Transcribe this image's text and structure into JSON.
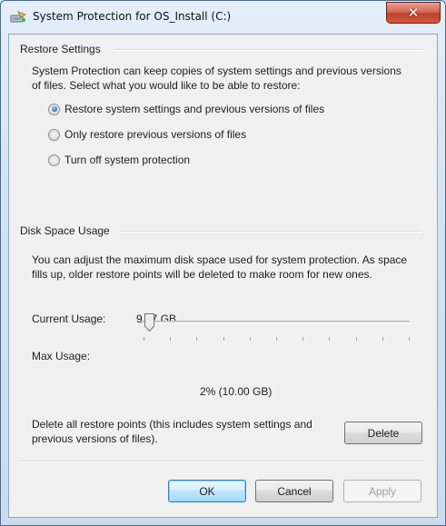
{
  "window": {
    "title": "System Protection for OS_Install (C:)",
    "close_label": "✕"
  },
  "restore_settings": {
    "group_title": "Restore Settings",
    "description": "System Protection can keep copies of system settings and previous versions of files. Select what you would like to be able to restore:",
    "options": [
      {
        "label": "Restore system settings and previous versions of files",
        "checked": true
      },
      {
        "label": "Only restore previous versions of files",
        "checked": false
      },
      {
        "label": "Turn off system protection",
        "checked": false
      }
    ]
  },
  "disk_space": {
    "group_title": "Disk Space Usage",
    "description": "You can adjust the maximum disk space used for system protection. As space fills up, older restore points will be deleted to make room for new ones.",
    "current_usage_label": "Current Usage:",
    "current_usage_value": "9.17 GB",
    "max_usage_label": "Max Usage:",
    "max_usage_percent": 2,
    "max_usage_display": "2% (10.00 GB)",
    "delete_description": "Delete all restore points (this includes system settings and previous versions of files).",
    "delete_label": "Delete"
  },
  "buttons": {
    "ok": "OK",
    "cancel": "Cancel",
    "apply": "Apply"
  }
}
